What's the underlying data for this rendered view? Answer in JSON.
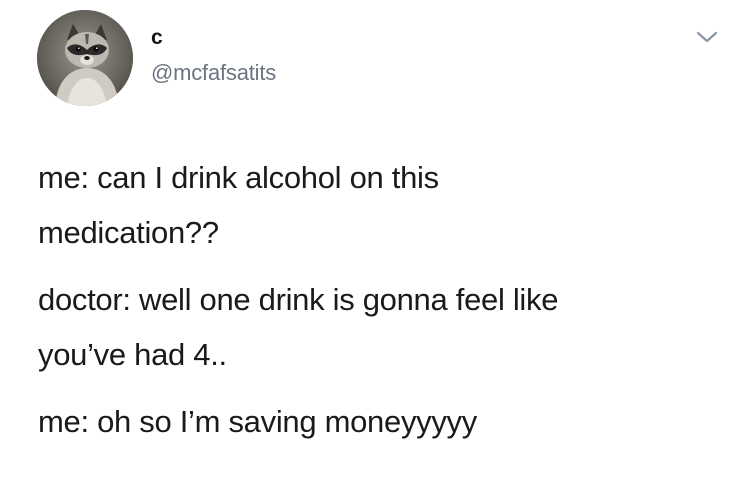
{
  "tweet": {
    "display_name": "c",
    "handle": "@mcfafsatits",
    "avatar_icon": "raccoon-avatar-icon",
    "menu_icon": "chevron-down-icon",
    "body": [
      {
        "lines": [
          "me: can I drink alcohol on this",
          "medication??"
        ]
      },
      {
        "lines": [
          "doctor: well one drink is gonna feel like",
          "you’ve had 4.."
        ]
      },
      {
        "lines": [
          "me: oh so I’m saving moneyyyyy"
        ]
      }
    ]
  },
  "colors": {
    "background": "#ffffff",
    "text": "#1a1a1a",
    "handle": "#6b7480",
    "chevron": "#8a96a3"
  }
}
